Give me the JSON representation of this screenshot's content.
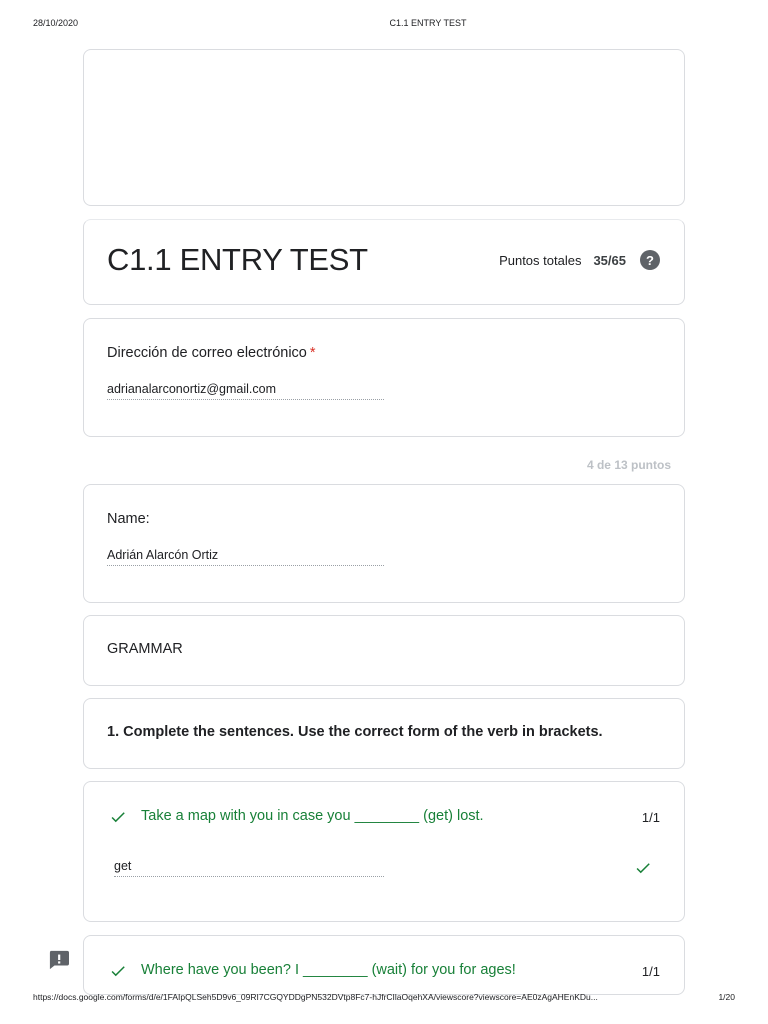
{
  "print_header": {
    "date": "28/10/2020",
    "title": "C1.1 ENTRY TEST"
  },
  "form": {
    "title": "C1.1 ENTRY TEST",
    "points_label": "Puntos totales",
    "points_value": "35/65",
    "help_icon": "help-circle-icon"
  },
  "email_question": {
    "label": "Dirección de correo electrónico",
    "required_mark": "*",
    "answer": "adrianalarconortiz@gmail.com"
  },
  "section_score": "4 de 13 puntos",
  "name_question": {
    "label": "Name:",
    "answer": "Adrián Alarcón Ortiz"
  },
  "section": {
    "title": "GRAMMAR"
  },
  "instruction": {
    "text": "1. Complete the sentences. Use the correct form of the verb in brackets."
  },
  "questions": [
    {
      "text": "Take a map with you in case you ________ (get) lost.",
      "score": "1/1",
      "answer": "get",
      "status": "correct"
    },
    {
      "text": "Where have you been? I ________ (wait) for you for ages!",
      "score": "1/1",
      "status": "correct"
    }
  ],
  "colors": {
    "correct_green": "#188038",
    "required_red": "#d93025",
    "border": "#dadce0"
  },
  "print_footer": {
    "url": "https://docs.google.com/forms/d/e/1FAIpQLSeh5D9v6_09RI7CGQYDDgPN532DVtp8Fc7-hJfrCIlaOqehXA/viewscore?viewscore=AE0zAgAHEnKDu...",
    "page": "1/20"
  }
}
